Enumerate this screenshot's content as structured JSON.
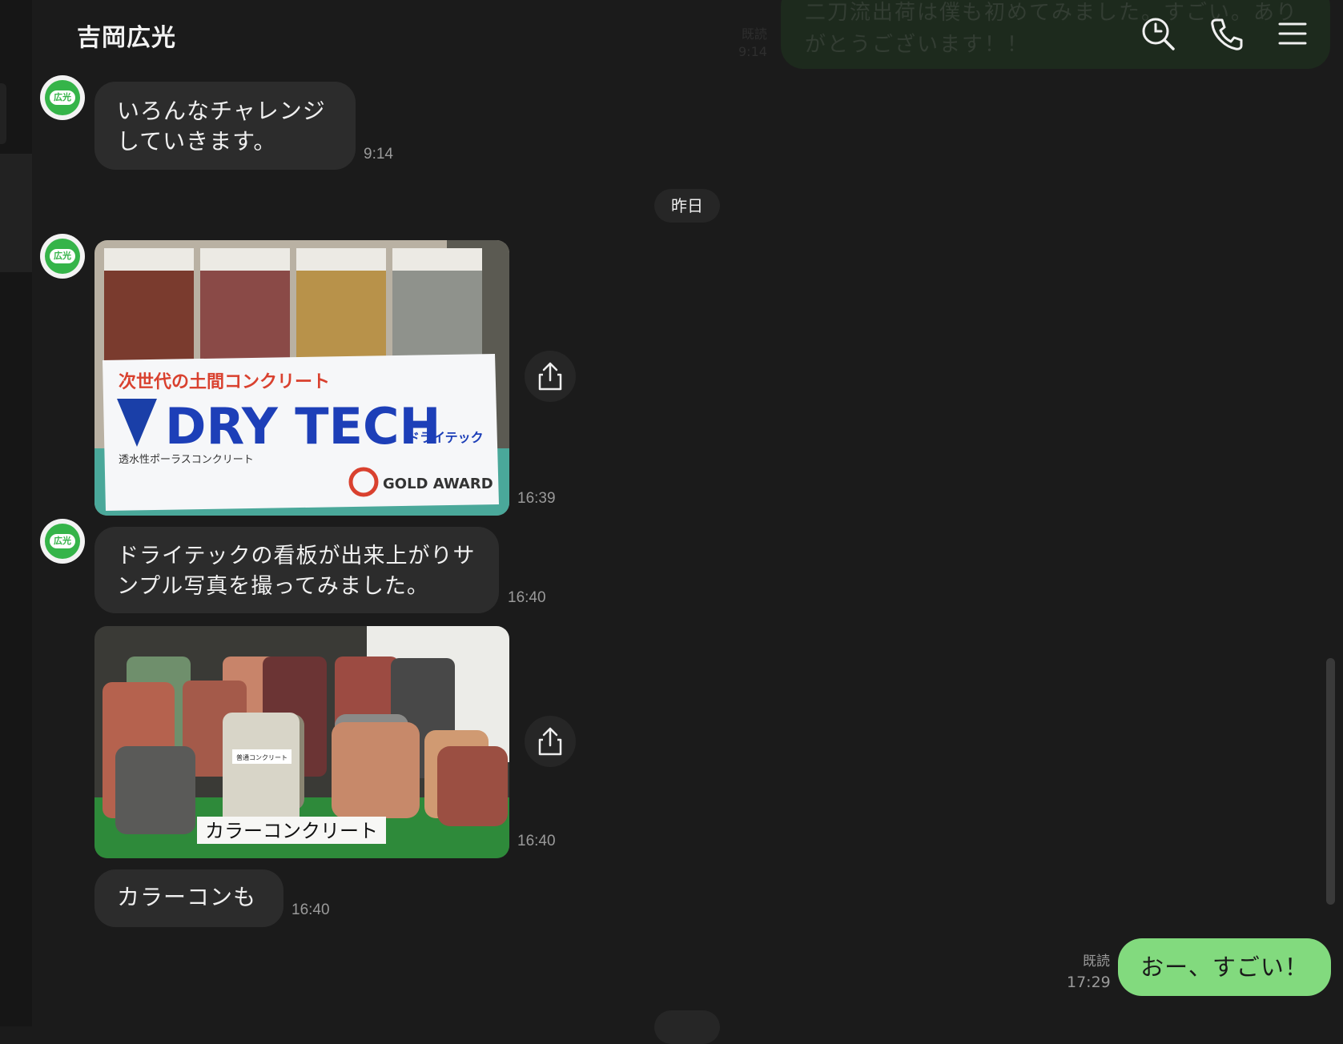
{
  "header": {
    "title": "吉岡広光",
    "icons": [
      "search-clock-icon",
      "phone-icon",
      "menu-icon"
    ]
  },
  "ghost_message": {
    "text": "二刀流出荷は僕も初めてみました。すごい。ありがとうございます！！",
    "read": "既読",
    "time": "9:14"
  },
  "avatar_label": "広光",
  "messages": [
    {
      "type": "text",
      "text": "いろんなチャレンジしていきます。",
      "time": "9:14"
    },
    {
      "type": "image",
      "caption_lines": [
        "次世代の土間コンクリート",
        "DRY TECH",
        "ドライテック",
        "透水性ポーラスコンクリート",
        "GOLD AWARD"
      ],
      "time": "16:39"
    },
    {
      "type": "text",
      "text": "ドライテックの看板が出来上がりサンプル写真を撮ってみました。",
      "time": "16:40"
    },
    {
      "type": "image",
      "caption_lines": [
        "カラーコンクリート",
        "普通コンクリート"
      ],
      "time": "16:40"
    },
    {
      "type": "text",
      "text": "カラーコンも",
      "time": "16:40"
    }
  ],
  "date_separator": "昨日",
  "outgoing": {
    "text": "おー、すごい！",
    "read": "既読",
    "time": "17:29"
  },
  "colors": {
    "background": "#1b1b1b",
    "bubble_in": "#2c2c2c",
    "bubble_out": "#82da7e",
    "avatar": "#35b449"
  }
}
